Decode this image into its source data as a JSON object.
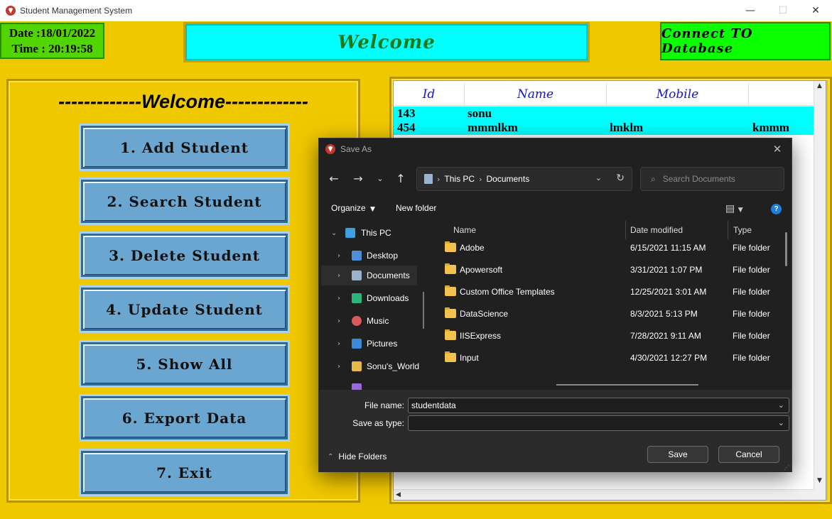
{
  "window": {
    "title": "Student Management System",
    "minimize": "—",
    "maximize": "☐",
    "close": "✕"
  },
  "header": {
    "date": "Date :18/01/2022",
    "time": "Time : 20:19:58",
    "banner": "Welcome",
    "connect_button": "Connect TO Database"
  },
  "left_panel": {
    "heading": "-------------Welcome-------------",
    "buttons": [
      "1. Add Student",
      "2. Search Student",
      "3. Delete Student",
      "4. Update Student",
      "5. Show All",
      "6. Export Data",
      "7. Exit"
    ]
  },
  "table": {
    "columns": [
      "Id",
      "Name",
      "Mobile",
      ""
    ],
    "rows": [
      {
        "id": "143",
        "name": "sonu",
        "mobile": "",
        "extra": ""
      },
      {
        "id": "454",
        "name": "mmmlkm",
        "mobile": "lmklm",
        "extra": "kmmm"
      }
    ]
  },
  "dialog": {
    "title": "Save As",
    "address": {
      "segments": [
        "This PC",
        "Documents"
      ]
    },
    "search_placeholder": "Search Documents",
    "toolbar": {
      "organize": "Organize",
      "new_folder": "New folder"
    },
    "tree": [
      {
        "label": "This PC",
        "icon": "computer-icon",
        "expanded": true,
        "indent": 0
      },
      {
        "label": "Desktop",
        "icon": "desktop-icon",
        "indent": 1
      },
      {
        "label": "Documents",
        "icon": "documents-icon",
        "indent": 1,
        "selected": true
      },
      {
        "label": "Downloads",
        "icon": "downloads-icon",
        "indent": 1
      },
      {
        "label": "Music",
        "icon": "music-icon",
        "indent": 1
      },
      {
        "label": "Pictures",
        "icon": "pictures-icon",
        "indent": 1
      },
      {
        "label": "Sonu's_World",
        "icon": "user-folder-icon",
        "indent": 1
      }
    ],
    "file_columns": [
      "Name",
      "Date modified",
      "Type"
    ],
    "files": [
      {
        "name": "Adobe",
        "modified": "6/15/2021 11:15 AM",
        "type": "File folder"
      },
      {
        "name": "Apowersoft",
        "modified": "3/31/2021 1:07 PM",
        "type": "File folder"
      },
      {
        "name": "Custom Office Templates",
        "modified": "12/25/2021 3:01 AM",
        "type": "File folder"
      },
      {
        "name": "DataScience",
        "modified": "8/3/2021 5:13 PM",
        "type": "File folder"
      },
      {
        "name": "IISExpress",
        "modified": "7/28/2021 9:11 AM",
        "type": "File folder"
      },
      {
        "name": "Input",
        "modified": "4/30/2021 12:27 PM",
        "type": "File folder"
      }
    ],
    "file_name_label": "File name:",
    "file_name_value": "studentdata",
    "save_as_type_label": "Save as type:",
    "save_as_type_value": "",
    "hide_folders": "Hide Folders",
    "save_button": "Save",
    "cancel_button": "Cancel"
  },
  "colors": {
    "background": "#f0c800",
    "banner": "#00ffff",
    "connect": "#0aff00",
    "menu_button": "#6aa6cf",
    "row_highlight": "#00ffff",
    "dialog_bg": "#202020"
  }
}
